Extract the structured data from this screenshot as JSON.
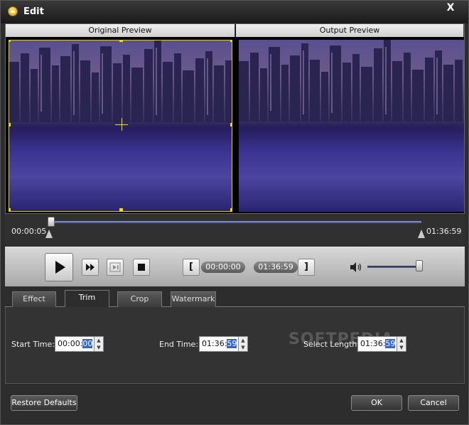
{
  "window": {
    "title": "Edit",
    "close_glyph": "X"
  },
  "preview": {
    "original_label": "Original Preview",
    "output_label": "Output Preview"
  },
  "timeline": {
    "start_time": "00:00:05",
    "end_time": "01:36:59"
  },
  "controls": {
    "start_marker_time": "00:00:00",
    "end_marker_time": "01:36:59",
    "left_bracket": "[",
    "right_bracket": "]"
  },
  "tabs": [
    {
      "label": "Effect"
    },
    {
      "label": "Trim",
      "active": true
    },
    {
      "label": "Crop"
    },
    {
      "label": "Watermark"
    }
  ],
  "trim": {
    "start_label": "Start Time:",
    "start_value_prefix": "00:00:",
    "start_value_selected": "00",
    "end_label": "End Time:",
    "end_value_prefix": "01:36:",
    "end_value_selected": "59",
    "length_label": "Select Length:",
    "length_value_prefix": "01:36:",
    "length_value_selected": "59"
  },
  "watermark_text": "SOFTPEDIA",
  "footer": {
    "restore_label": "Restore Defaults",
    "ok_label": "OK",
    "cancel_label": "Cancel"
  },
  "colors": {
    "accent_yellow": "#f2de00",
    "slider_blue": "#5a6aa0"
  }
}
